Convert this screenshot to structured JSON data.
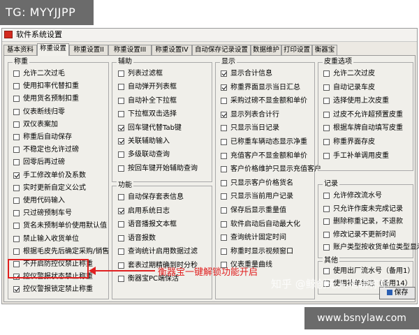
{
  "watermark_top": "TG: MYYJJPP",
  "watermark_bottom": "www.bsnylaw.com",
  "watermark_zhihu": "知乎 @鲸创无人地磅称重",
  "window": {
    "title": "软件系统设置",
    "icon": "app-icon"
  },
  "tabs": [
    {
      "label": "基本资料",
      "active": false
    },
    {
      "label": "称重设置",
      "active": true
    },
    {
      "label": "称重设置II",
      "active": false
    },
    {
      "label": "称重设置III",
      "active": false
    },
    {
      "label": "称重设置IV",
      "active": false
    },
    {
      "label": "自动保存记录设置",
      "active": false
    },
    {
      "label": "数据维护",
      "active": false
    },
    {
      "label": "打印设置",
      "active": false
    },
    {
      "label": "衡器宝",
      "active": false
    }
  ],
  "groups": {
    "chengzhong": {
      "title": "称重",
      "items": [
        {
          "label": "允许二次过毛",
          "checked": false
        },
        {
          "label": "使用扣率代替扣重",
          "checked": false
        },
        {
          "label": "使用货名预制扣重",
          "checked": false
        },
        {
          "label": "仪表断线归零",
          "checked": false
        },
        {
          "label": "双仪表案加",
          "checked": false
        },
        {
          "label": "称重后自动保存",
          "checked": false
        },
        {
          "label": "不稳定也允许过磅",
          "checked": false
        },
        {
          "label": "回零后再过磅",
          "checked": false
        },
        {
          "label": "手工修改单价及系数",
          "checked": true
        },
        {
          "label": "实时更新自定义公式",
          "checked": false
        },
        {
          "label": "使用代码输入",
          "checked": false
        },
        {
          "label": "只过磅预制车号",
          "checked": false
        },
        {
          "label": "货名未预制单价使用默认值",
          "checked": false
        },
        {
          "label": "禁止输入收货单位",
          "checked": false
        },
        {
          "label": "根据毛皮先后确定采购/销售",
          "checked": false
        },
        {
          "label": "不开启防控仪禁止称重",
          "checked": false
        },
        {
          "label": "控仪警报状态禁止称重",
          "checked": true
        },
        {
          "label": "控仪警报锁定禁止称重",
          "checked": true
        }
      ]
    },
    "fuzhu": {
      "title": "辅助",
      "items": [
        {
          "label": "列表过滤框",
          "checked": false
        },
        {
          "label": "自动弹开列表框",
          "checked": false
        },
        {
          "label": "自动补全下拉框",
          "checked": false
        },
        {
          "label": "下拉框双击选择",
          "checked": false
        },
        {
          "label": "回车键代替Tab键",
          "checked": true
        },
        {
          "label": "关联辅助输入",
          "checked": true
        },
        {
          "label": "多级联动查询",
          "checked": false
        },
        {
          "label": "按回车键开始辅助查询",
          "checked": false
        }
      ]
    },
    "gongneng": {
      "title": "功能",
      "items": [
        {
          "label": "自动保存套表信息",
          "checked": false
        },
        {
          "label": "启用系统日志",
          "checked": true
        },
        {
          "label": "语音播报文本框",
          "checked": false
        },
        {
          "label": "语音报数",
          "checked": false
        },
        {
          "label": "查询统计启用数据过滤",
          "checked": false
        },
        {
          "label": "套表过期精确到时分秒",
          "checked": false
        },
        {
          "label": "衡器宝PC端保活",
          "checked": false
        }
      ]
    },
    "xianshi": {
      "title": "显示",
      "items": [
        {
          "label": "显示合计信息",
          "checked": true
        },
        {
          "label": "称重界面显示当日汇总",
          "checked": true
        },
        {
          "label": "采购过磅不显金额和单价",
          "checked": false
        },
        {
          "label": "显示列表合计行",
          "checked": true
        },
        {
          "label": "只显示当日记录",
          "checked": false
        },
        {
          "label": "已称重车辆动态显示净重",
          "checked": false
        },
        {
          "label": "充值客户不显金额和单价",
          "checked": false
        },
        {
          "label": "客户价格维护只显示充值客户",
          "checked": false
        },
        {
          "label": "只显示客户价格货名",
          "checked": false
        },
        {
          "label": "只显示当前用户记录",
          "checked": false
        },
        {
          "label": "保存后显示重量值",
          "checked": false
        },
        {
          "label": "软件启动后自动最大化",
          "checked": false
        },
        {
          "label": "查询统计固定时间",
          "checked": false
        },
        {
          "label": "称重时显示视频窗口",
          "checked": false
        },
        {
          "label": "仪表重量曲线",
          "checked": false
        }
      ]
    },
    "pixuanxiang": {
      "title": "皮重选项",
      "items": [
        {
          "label": "允许二次过皮",
          "checked": false
        },
        {
          "label": "自动记录车皮",
          "checked": false
        },
        {
          "label": "选择使用上次皮重",
          "checked": false
        },
        {
          "label": "过皮不允许超预置皮重",
          "checked": false
        },
        {
          "label": "根据车牌自动填写皮重",
          "checked": false
        },
        {
          "label": "称重界面存皮",
          "checked": false
        },
        {
          "label": "手工补单调用皮重",
          "checked": false
        }
      ]
    },
    "jilu": {
      "title": "记录",
      "items": [
        {
          "label": "允许修改流水号",
          "checked": false
        },
        {
          "label": "只允许作废未完成记录",
          "checked": false
        },
        {
          "label": "删除称重记录，不退款",
          "checked": false
        },
        {
          "label": "修改记录不更新时间",
          "checked": false
        },
        {
          "label": "账户类型按收货单位类型显示",
          "checked": false
        }
      ]
    },
    "qita": {
      "title": "其他",
      "items": [
        {
          "label": "使用出厂流水号（备用1）",
          "checked": false
        },
        {
          "label": "使用补单标志（备用14）",
          "checked": false
        }
      ]
    }
  },
  "save_button": {
    "label": "保存",
    "icon": "save-icon"
  },
  "annotation": {
    "text": "衡器宝一键解锁功能开启",
    "color": "#e02020"
  }
}
